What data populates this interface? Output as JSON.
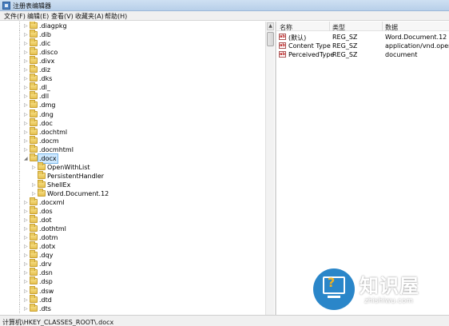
{
  "window": {
    "title": "注册表编辑器"
  },
  "menu": [
    "文件(F)",
    "编辑(E)",
    "查看(V)",
    "收藏夹(A)",
    "帮助(H)"
  ],
  "tree": {
    "items": [
      {
        "label": ".diagpkg",
        "level": 0,
        "expander": "▷"
      },
      {
        "label": ".dib",
        "level": 0,
        "expander": "▷"
      },
      {
        "label": ".dic",
        "level": 0,
        "expander": "▷"
      },
      {
        "label": ".disco",
        "level": 0,
        "expander": "▷"
      },
      {
        "label": ".divx",
        "level": 0,
        "expander": "▷"
      },
      {
        "label": ".diz",
        "level": 0,
        "expander": "▷"
      },
      {
        "label": ".dks",
        "level": 0,
        "expander": "▷"
      },
      {
        "label": ".dl_",
        "level": 0,
        "expander": "▷"
      },
      {
        "label": ".dll",
        "level": 0,
        "expander": "▷"
      },
      {
        "label": ".dmg",
        "level": 0,
        "expander": "▷"
      },
      {
        "label": ".dng",
        "level": 0,
        "expander": "▷"
      },
      {
        "label": ".doc",
        "level": 0,
        "expander": "▷"
      },
      {
        "label": ".dochtml",
        "level": 0,
        "expander": "▷"
      },
      {
        "label": ".docm",
        "level": 0,
        "expander": "▷"
      },
      {
        "label": ".docmhtml",
        "level": 0,
        "expander": "▷"
      },
      {
        "label": ".docx",
        "level": 0,
        "expander": "◢",
        "selected": true
      },
      {
        "label": "OpenWithList",
        "level": 1,
        "expander": "▷"
      },
      {
        "label": "PersistentHandler",
        "level": 1,
        "expander": ""
      },
      {
        "label": "ShellEx",
        "level": 1,
        "expander": "▷"
      },
      {
        "label": "Word.Document.12",
        "level": 1,
        "expander": "▷"
      },
      {
        "label": ".docxml",
        "level": 0,
        "expander": "▷"
      },
      {
        "label": ".dos",
        "level": 0,
        "expander": "▷"
      },
      {
        "label": ".dot",
        "level": 0,
        "expander": "▷"
      },
      {
        "label": ".dothtml",
        "level": 0,
        "expander": "▷"
      },
      {
        "label": ".dotm",
        "level": 0,
        "expander": "▷"
      },
      {
        "label": ".dotx",
        "level": 0,
        "expander": "▷"
      },
      {
        "label": ".dqy",
        "level": 0,
        "expander": "▷"
      },
      {
        "label": ".drv",
        "level": 0,
        "expander": "▷"
      },
      {
        "label": ".dsn",
        "level": 0,
        "expander": "▷"
      },
      {
        "label": ".dsp",
        "level": 0,
        "expander": "▷"
      },
      {
        "label": ".dsw",
        "level": 0,
        "expander": "▷"
      },
      {
        "label": ".dtd",
        "level": 0,
        "expander": "▷"
      },
      {
        "label": ".dts",
        "level": 0,
        "expander": "▷"
      }
    ]
  },
  "values": {
    "headers": {
      "name": "名称",
      "type": "类型",
      "data": "数据"
    },
    "rows": [
      {
        "name": "(默认)",
        "type": "REG_SZ",
        "data": "Word.Document.12"
      },
      {
        "name": "Content Type",
        "type": "REG_SZ",
        "data": "application/vnd.openxml"
      },
      {
        "name": "PerceivedType",
        "type": "REG_SZ",
        "data": "document"
      }
    ],
    "icon_text": "ab"
  },
  "status": {
    "path": "计算机\\HKEY_CLASSES_ROOT\\.docx"
  },
  "watermark": {
    "title": "知识屋",
    "subtitle": "zhishiwu.com",
    "mark": "?"
  },
  "scrollbar": {
    "up": "▲"
  }
}
